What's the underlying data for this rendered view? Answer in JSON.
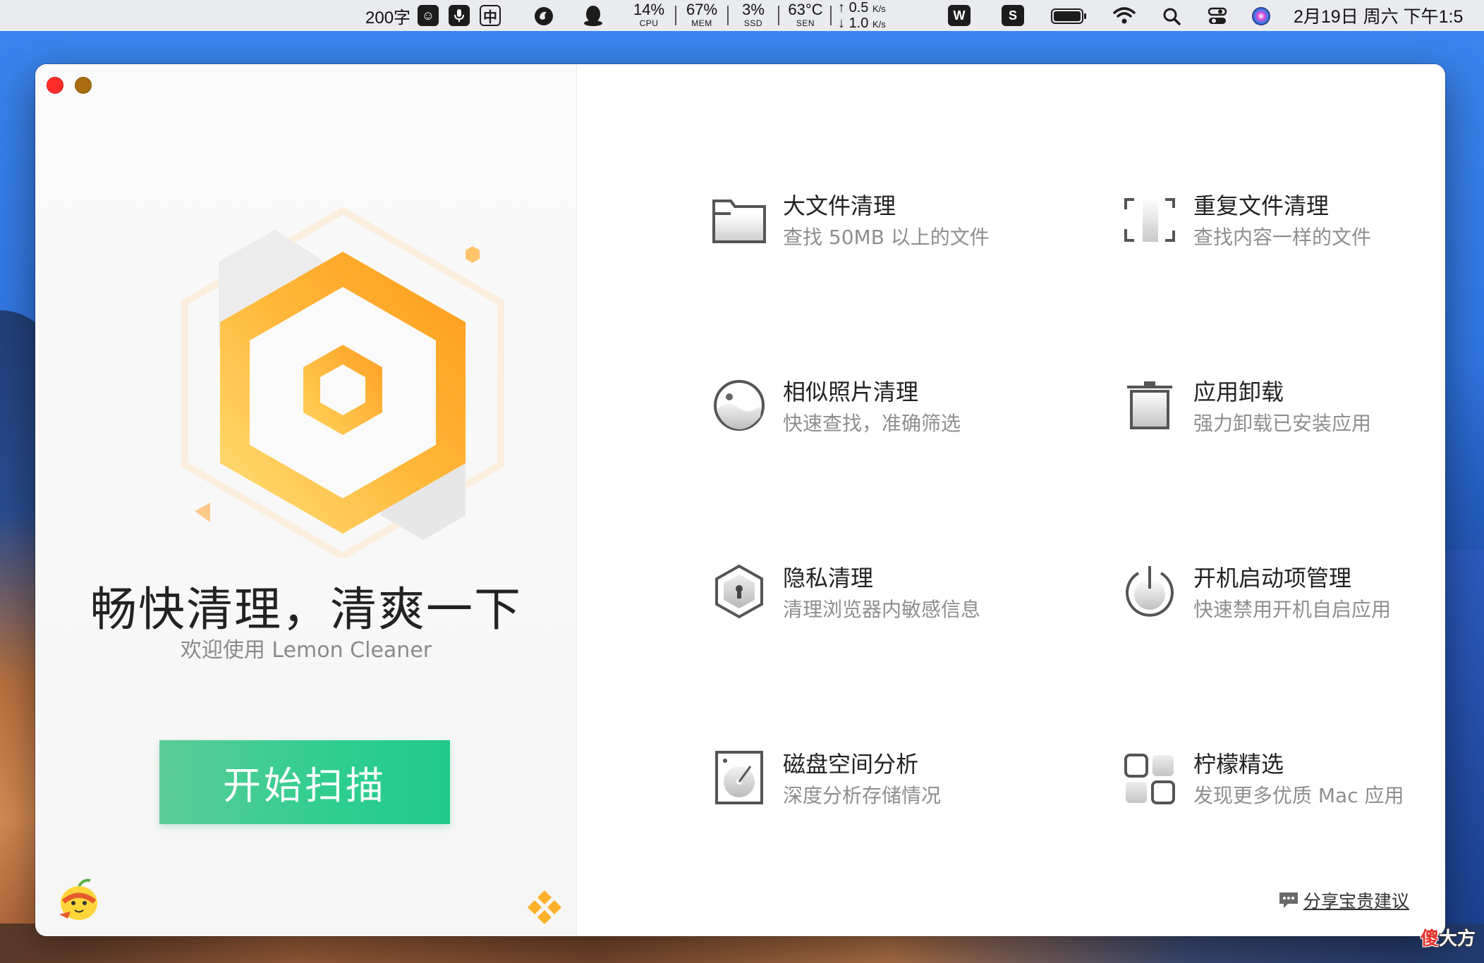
{
  "menubar": {
    "word_count": "200字",
    "ime_label": "中",
    "stats": [
      {
        "value": "14%",
        "label": "CPU"
      },
      {
        "value": "67%",
        "label": "MEM"
      },
      {
        "value": "3%",
        "label": "SSD"
      },
      {
        "value": "63°C",
        "label": "SEN"
      }
    ],
    "net_up": "0.5",
    "net_down": "1.0",
    "net_unit": "K/s",
    "datetime": "2月19日 周六 下午1:5"
  },
  "app": {
    "slogan": "畅快清理，清爽一下",
    "welcome": "欢迎使用 Lemon Cleaner",
    "scan_button": "开始扫描",
    "feedback": "分享宝贵建议",
    "accent_color": "#2fce8f",
    "brand_color": "#ffa21f"
  },
  "features": [
    {
      "title": "大文件清理",
      "desc": "查找 50MB 以上的文件",
      "icon": "folder-icon"
    },
    {
      "title": "重复文件清理",
      "desc": "查找内容一样的文件",
      "icon": "duplicate-file-icon"
    },
    {
      "title": "相似照片清理",
      "desc": "快速查找，准确筛选",
      "icon": "photo-icon"
    },
    {
      "title": "应用卸载",
      "desc": "强力卸载已安装应用",
      "icon": "trash-icon"
    },
    {
      "title": "隐私清理",
      "desc": "清理浏览器内敏感信息",
      "icon": "privacy-shield-icon"
    },
    {
      "title": "开机启动项管理",
      "desc": "快速禁用开机自启应用",
      "icon": "power-icon"
    },
    {
      "title": "磁盘空间分析",
      "desc": "深度分析存储情况",
      "icon": "disk-icon"
    },
    {
      "title": "柠檬精选",
      "desc": "发现更多优质 Mac 应用",
      "icon": "app-grid-icon"
    }
  ],
  "watermark": {
    "red_part": "傻",
    "rest": "大方"
  }
}
